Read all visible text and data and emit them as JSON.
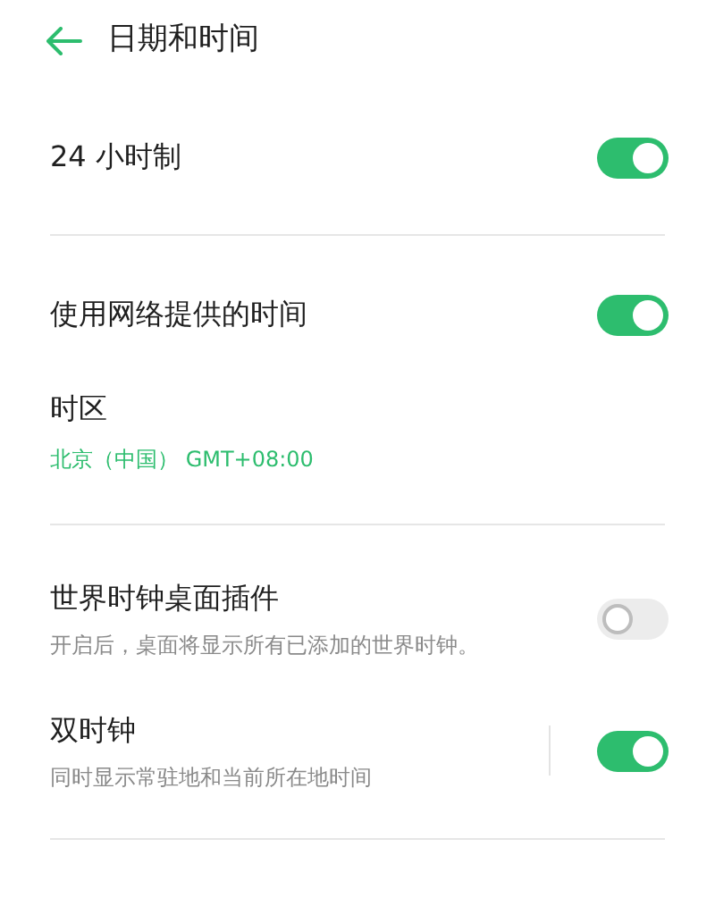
{
  "header": {
    "title": "日期和时间"
  },
  "sections": [
    {
      "items": [
        {
          "kind": "toggle",
          "label": "24 小时制",
          "on": true
        }
      ]
    },
    {
      "items": [
        {
          "kind": "toggle",
          "label": "使用网络提供的时间",
          "on": true
        },
        {
          "kind": "value",
          "label": "时区",
          "value": "北京（中国） GMT+08:00"
        }
      ]
    },
    {
      "items": [
        {
          "kind": "toggle",
          "label": "世界时钟桌面插件",
          "subtitle": "开启后，桌面将显示所有已添加的世界时钟。",
          "on": false,
          "divider": false
        },
        {
          "kind": "toggle",
          "label": "双时钟",
          "subtitle": "同时显示常驻地和当前所在地时间",
          "on": true,
          "divider": true
        }
      ]
    }
  ]
}
